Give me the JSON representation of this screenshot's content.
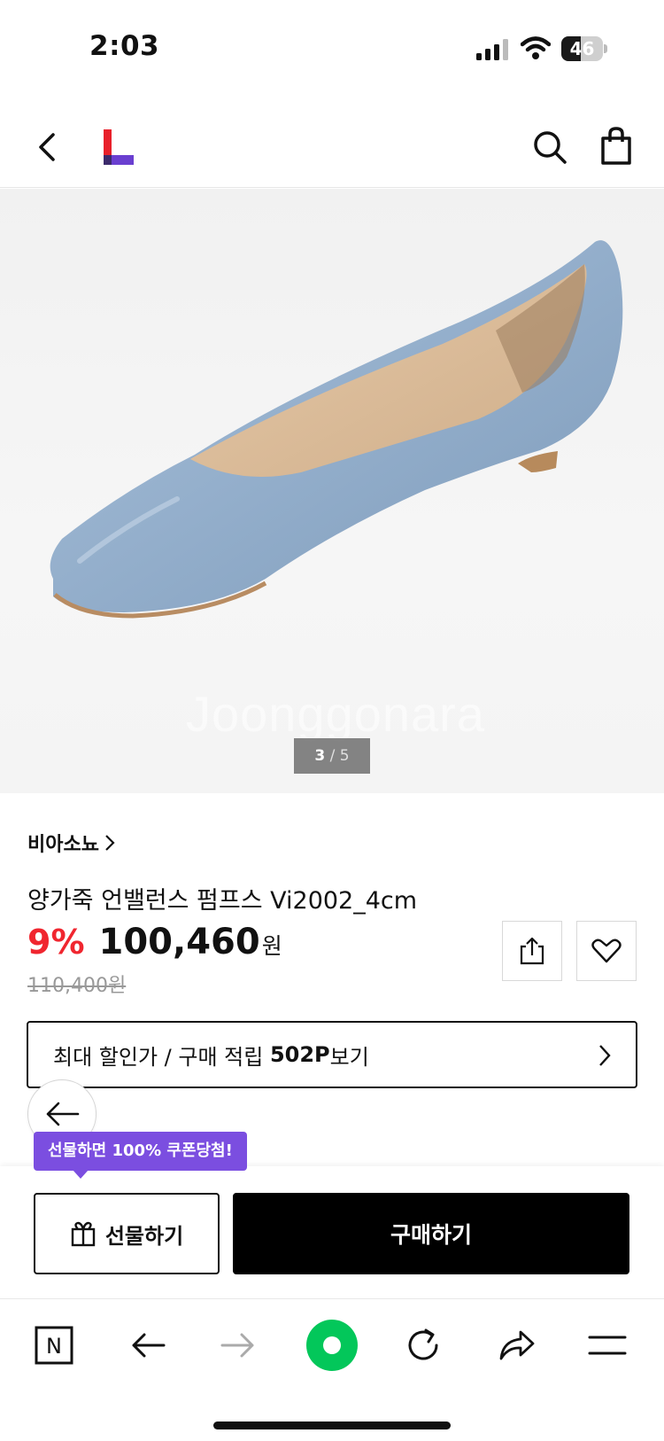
{
  "status_bar": {
    "time": "2:03",
    "battery": "46",
    "battery_level": 0.46
  },
  "header": {
    "back_icon": "chevron-left-icon",
    "logo_icon": "lotte-on-logo",
    "search_icon": "search-icon",
    "bag_icon": "shopping-bag-icon"
  },
  "gallery": {
    "current": "3",
    "separator": " / ",
    "total": "5",
    "watermark": "Joonggonara"
  },
  "product": {
    "brand": "비아소뇨",
    "name": "양가죽 언밸런스 펌프스 Vi2002_4cm",
    "discount_rate": "9%",
    "price": "100,460",
    "price_unit": "원",
    "original_price": "110,400원"
  },
  "benefit": {
    "prefix": "최대 할인가 / 구매 적립 ",
    "points": "502P",
    "suffix": "보기"
  },
  "partial_text": {
    "left": "",
    "right": ""
  },
  "actions": {
    "gift_tooltip": "선물하면 100% 쿠폰당첨!",
    "gift_label": "선물하기",
    "buy_label": "구매하기"
  },
  "colors": {
    "discount": "#f0262f",
    "tooltip": "#7b4ee0",
    "logo_red": "#e8202a",
    "logo_purple": "#6a3fd0",
    "naver_green": "#03c75a"
  },
  "browser": {
    "n_label": "N"
  }
}
